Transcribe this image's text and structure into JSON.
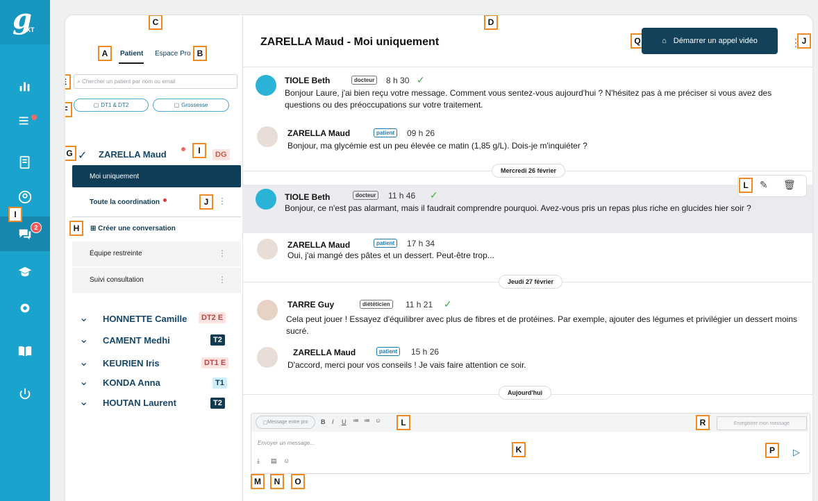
{
  "app": {
    "logo": "g",
    "logo_sub": "XT"
  },
  "rail": {
    "messages_badge": "2"
  },
  "sidebar": {
    "tabs": [
      {
        "label": "Patient"
      },
      {
        "label": "Espace Pro"
      }
    ],
    "search_placeholder": "Chercher un patient par nom ou email",
    "chips": [
      {
        "label": "DT1 & DT2"
      },
      {
        "label": "Grossesse"
      }
    ],
    "patients": [
      {
        "name": "ZARELLA Maud",
        "tag": "DG"
      },
      {
        "name": "HONNETTE Camille",
        "tag": "DT2 E"
      },
      {
        "name": "CAMENT Medhi",
        "tag": "T2"
      },
      {
        "name": "KEURIEN Iris",
        "tag": "DT1 E"
      },
      {
        "name": "KONDA Anna",
        "tag": "T1"
      },
      {
        "name": "HOUTAN Laurent",
        "tag": "T2"
      }
    ],
    "conversations": [
      {
        "label": "Moi uniquement"
      },
      {
        "label": "Toute la coordination"
      },
      {
        "label": "Créer une conversation"
      },
      {
        "label": "Équipe restreinte"
      },
      {
        "label": "Suivi consultation"
      }
    ]
  },
  "chat": {
    "title": "ZARELLA Maud - Moi uniquement",
    "video_button": "Démarrer un appel vidéo",
    "messages": [
      {
        "author": "TIOLE Beth",
        "role": "docteur",
        "time": "8 h 30",
        "text": "Bonjour Laure, j'ai bien reçu votre message. Comment vous sentez-vous aujourd'hui ? N'hésitez pas à me préciser si vous avez des questions ou des préoccupations sur votre traitement."
      },
      {
        "author": "ZARELLA Maud",
        "role": "patient",
        "time": "09 h 26",
        "text": "Bonjour, ma glycémie est un peu élevée ce matin (1,85 g/L). Dois-je m'inquiéter ?"
      },
      {
        "author": "TIOLE Beth",
        "role": "docteur",
        "time": "11 h 46",
        "text": "Bonjour, ce n'est pas alarmant, mais il faudrait comprendre pourquoi. Avez-vous pris un repas plus riche en glucides hier soir ?"
      },
      {
        "author": "ZARELLA Maud",
        "role": "patient",
        "time": "17 h 34",
        "text": "Oui, j'ai mangé des pâtes et un dessert. Peut-être trop..."
      },
      {
        "author": "TARRE Guy",
        "role": "diététicien",
        "time": "11 h 21",
        "text": "Cela peut jouer ! Essayez d'équilibrer avec plus de fibres et de protéines. Par exemple, ajouter des légumes et privilégier un dessert moins sucré."
      },
      {
        "author": "ZARELLA Maud",
        "role": "patient",
        "time": "15 h 26",
        "text": "D'accord, merci pour vos conseils ! Je vais faire attention ce soir."
      }
    ],
    "dates": [
      "Mercredi 26 février",
      "Jeudi 27 février",
      "Aujourd'hui"
    ],
    "composer": {
      "pro_toggle": "Message entre pro",
      "placeholder": "Envoyer un message...",
      "save_button": "Enregistrer mon message"
    }
  },
  "labels": {
    "A": "A",
    "B": "B",
    "C": "C",
    "D": "D",
    "E": "E",
    "F": "F",
    "G": "G",
    "H": "H",
    "I": "I",
    "J": "J",
    "K": "K",
    "L": "L",
    "M": "M",
    "N": "N",
    "O": "O",
    "P": "P",
    "Q": "Q",
    "R": "R"
  }
}
